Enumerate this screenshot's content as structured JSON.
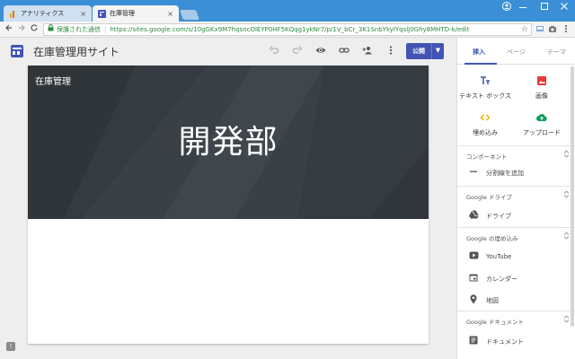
{
  "browser": {
    "tabs": [
      {
        "label": "アナリティクス",
        "active": false
      },
      {
        "label": "在庫管理",
        "active": true
      }
    ],
    "close_glyph": "×",
    "address": {
      "secure_label": "保護された通信",
      "url": "https://sites.google.com/s/10gGKx9M7hqsncOlEYP0HF5KQqg1ykNr7/p/1V_bCr_3K1SnbYkylYqslJ0Ghy8MHTD-k/edit"
    }
  },
  "app": {
    "site_title": "在庫管理用サイト",
    "publish_label": "公開"
  },
  "canvas": {
    "hero_small": "在庫管理",
    "hero_big": "開発部"
  },
  "panel": {
    "tabs": [
      "挿入",
      "ページ",
      "テーマ"
    ],
    "insert_items": [
      {
        "icon": "text-box-icon",
        "label": "テキスト ボックス"
      },
      {
        "icon": "image-icon",
        "label": "画像"
      },
      {
        "icon": "embed-icon",
        "label": "埋め込み"
      },
      {
        "icon": "upload-icon",
        "label": "アップロード"
      }
    ],
    "sections": [
      {
        "title": "コンポーネント",
        "items": [
          {
            "icon": "divider-icon",
            "label": "分割線を追加"
          }
        ]
      },
      {
        "title": "Google ドライブ",
        "items": [
          {
            "icon": "drive-icon",
            "label": "ドライブ"
          }
        ]
      },
      {
        "title": "Google の埋め込み",
        "items": [
          {
            "icon": "youtube-icon",
            "label": "YouTube"
          },
          {
            "icon": "calendar-icon",
            "label": "カレンダー"
          },
          {
            "icon": "map-pin-icon",
            "label": "地図"
          }
        ]
      },
      {
        "title": "Google ドキュメント",
        "items": [
          {
            "icon": "document-icon",
            "label": "ドキュメント"
          }
        ]
      }
    ]
  },
  "colors": {
    "accent": "#4154b3",
    "titlebar": "#3b8fd6",
    "hero_bg": "#394046",
    "secure_green": "#2e8b3d"
  }
}
